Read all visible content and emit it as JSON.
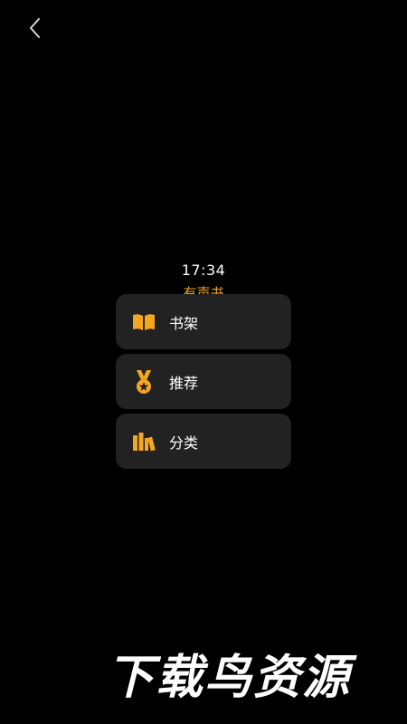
{
  "header": {
    "back_icon": "chevron-left-icon"
  },
  "clock": {
    "time": "17:34"
  },
  "app": {
    "title": "有声书"
  },
  "menu": {
    "items": [
      {
        "label": "书架",
        "icon": "open-book-icon"
      },
      {
        "label": "推荐",
        "icon": "medal-icon"
      },
      {
        "label": "分类",
        "icon": "category-books-icon"
      }
    ]
  },
  "watermark": {
    "text": "下载鸟资源"
  },
  "colors": {
    "background": "#000000",
    "card": "#222222",
    "accent": "#f5a623",
    "text": "#ffffff"
  }
}
